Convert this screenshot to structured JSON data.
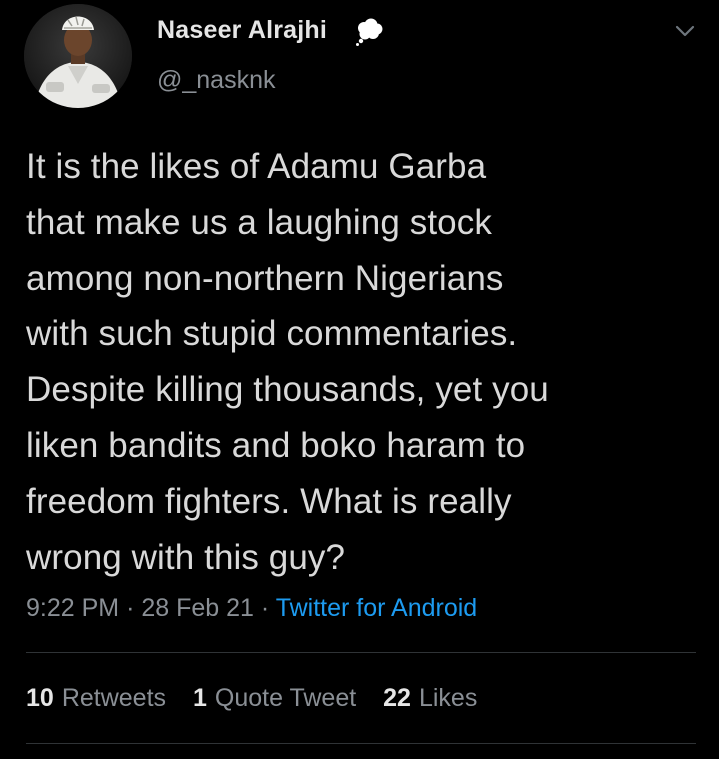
{
  "author": {
    "display_name": "Naseer Alrajhi",
    "handle": "@_nasknk",
    "badge_icon": "thought-bubble-icon"
  },
  "tweet": {
    "text": "It is the likes of Adamu Garba\nthat make us a laughing stock\namong non-northern Nigerians\nwith such stupid commentaries.\nDespite killing thousands, yet you\nliken bandits and boko haram to\nfreedom fighters. What is really\nwrong with this guy?",
    "time": "9:22 PM",
    "separator": "·",
    "date": "28 Feb 21",
    "source": "Twitter for Android"
  },
  "stats": {
    "retweets_count": "10",
    "retweets_label": "Retweets",
    "quotes_count": "1",
    "quotes_label": "Quote Tweet",
    "likes_count": "22",
    "likes_label": "Likes"
  },
  "colors": {
    "background": "#000000",
    "text": "#d9d9d9",
    "muted": "#8a8f95",
    "link": "#1d9bf0",
    "divider": "#2f3336"
  }
}
